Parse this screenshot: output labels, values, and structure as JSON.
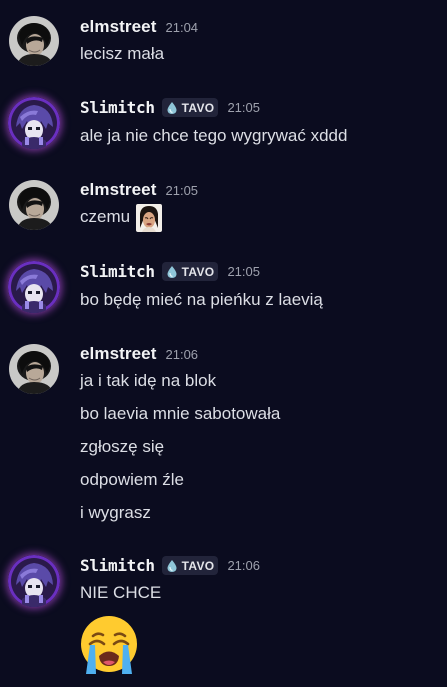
{
  "messages": [
    {
      "author": "elmstreet",
      "time": "21:04",
      "lines": [
        "lecisz mała"
      ]
    },
    {
      "author": "Slimitch",
      "tag": "TAVO",
      "time": "21:05",
      "lines": [
        "ale ja nie chce tego wygrywać xddd"
      ]
    },
    {
      "author": "elmstreet",
      "time": "21:05",
      "lines": [
        "czemu"
      ],
      "emoji": "kim-kardashian-crying-emoji"
    },
    {
      "author": "Slimitch",
      "tag": "TAVO",
      "time": "21:05",
      "lines": [
        "bo będę mieć na pieńku z laevią"
      ]
    },
    {
      "author": "elmstreet",
      "time": "21:06",
      "lines": [
        "ja i tak idę na blok",
        "bo laevia mnie sabotowała",
        "zgłoszę się",
        "odpowiem źle",
        "i wygrasz"
      ]
    },
    {
      "author": "Slimitch",
      "tag": "TAVO",
      "time": "21:06",
      "lines": [
        "NIE CHCE"
      ],
      "emoji": "loudly-crying-face-emoji"
    }
  ],
  "colors": {
    "background": "#0b0c1f",
    "username": "#f2f3f5",
    "text": "#dcdee5",
    "timestamp": "#9ea1ad",
    "tag_bg": "#22243a",
    "avatar_glow": "#d65aff"
  }
}
